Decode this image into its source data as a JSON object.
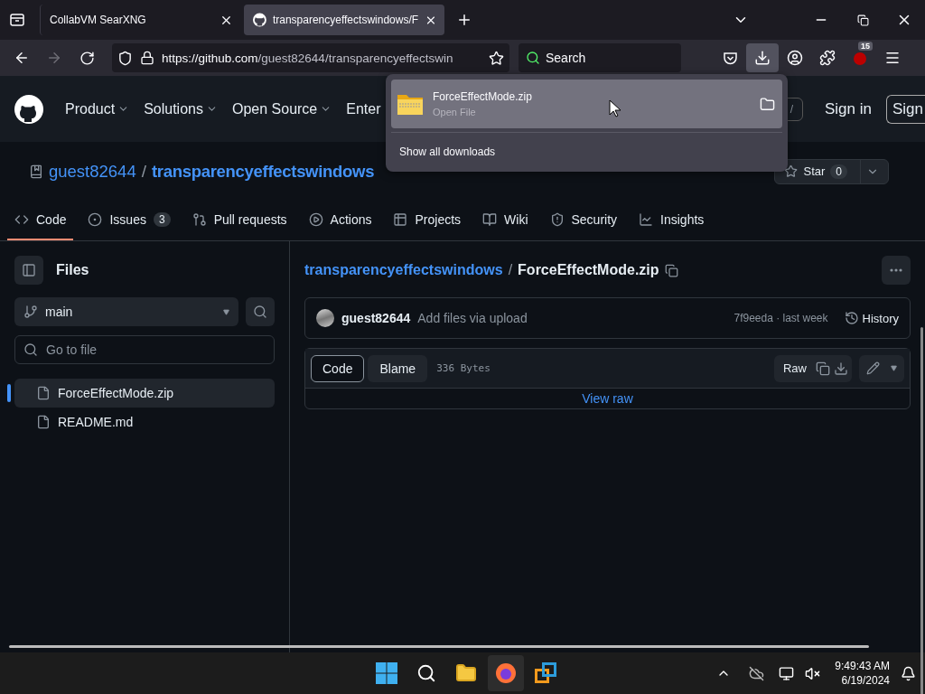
{
  "browser": {
    "tabs": [
      {
        "title": "CollabVM SearXNG",
        "selected": false
      },
      {
        "title": "transparencyeffectswindows/F",
        "selected": true
      }
    ],
    "url_host": "https://github.com",
    "url_path": "/guest82644/transparencyeffectswin",
    "can_go_forward": false,
    "search_placeholder": "Search",
    "extension_badge": "15"
  },
  "downloads_panel": {
    "file": "ForceEffectMode.zip",
    "action": "Open File",
    "show_all": "Show all downloads"
  },
  "header": {
    "nav": [
      {
        "label": "Product",
        "dropdown": true
      },
      {
        "label": "Solutions",
        "dropdown": true
      },
      {
        "label": "Open Source",
        "dropdown": true
      },
      {
        "label": "Enter",
        "dropdown": false
      }
    ],
    "search_key": "/",
    "sign_in": "Sign in",
    "sign_up": "Sign"
  },
  "repo": {
    "owner": "guest82644",
    "separator": "/",
    "name": "transparencyeffectswindows",
    "star_label": "Star",
    "star_count": "0"
  },
  "repo_tabs": [
    {
      "label": "Code",
      "selected": true
    },
    {
      "label": "Issues",
      "count": "3",
      "selected": false
    },
    {
      "label": "Pull requests",
      "selected": false
    },
    {
      "label": "Actions",
      "selected": false
    },
    {
      "label": "Projects",
      "selected": false
    },
    {
      "label": "Wiki",
      "selected": false
    },
    {
      "label": "Security",
      "selected": false
    },
    {
      "label": "Insights",
      "selected": false
    }
  ],
  "sidebar": {
    "title": "Files",
    "branch": "main",
    "search_placeholder": "Go to file",
    "files": [
      {
        "name": "ForceEffectMode.zip",
        "selected": true
      },
      {
        "name": "README.md",
        "selected": false
      }
    ]
  },
  "file_view": {
    "repo_link": "transparencyeffectswindows",
    "separator": "/",
    "file_name": "ForceEffectMode.zip",
    "commit_author": "guest82644",
    "commit_message": "Add files via upload",
    "commit_info": "7f9eeda · last week",
    "history": "History",
    "view_tabs": [
      {
        "label": "Code",
        "selected": true
      },
      {
        "label": "Blame",
        "selected": false
      }
    ],
    "size": "336 Bytes",
    "raw": "Raw",
    "view_raw": "View raw"
  },
  "taskbar": {
    "time": "9:49:43 AM",
    "date": "6/19/2024"
  }
}
